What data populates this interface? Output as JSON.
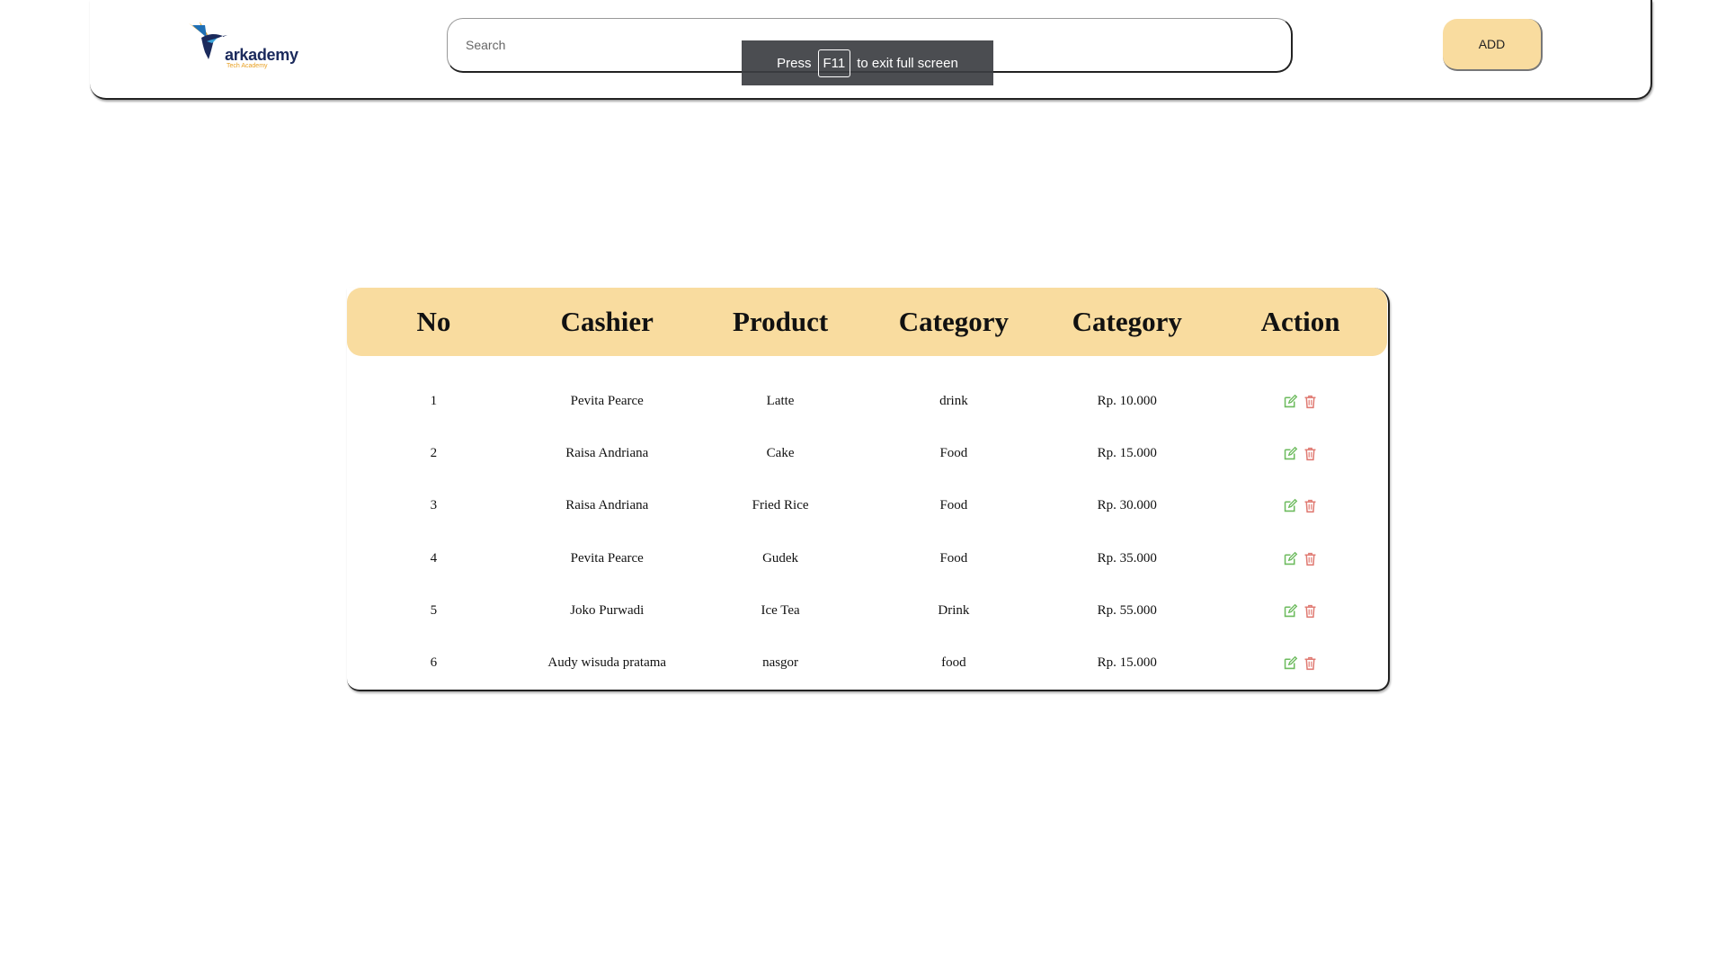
{
  "header": {
    "logo_text": "arkademy",
    "logo_subtext": "Tech Academy",
    "search_placeholder": "Search",
    "add_label": "ADD"
  },
  "fullscreen_notice": {
    "prefix": "Press",
    "key": "F11",
    "suffix": "to exit full screen"
  },
  "table": {
    "columns": [
      "No",
      "Cashier",
      "Product",
      "Category",
      "Category",
      "Action"
    ],
    "rows": [
      {
        "no": "1",
        "cashier": "Pevita Pearce",
        "product": "Latte",
        "category": "drink",
        "price": "Rp. 10.000"
      },
      {
        "no": "2",
        "cashier": "Raisa Andriana",
        "product": "Cake",
        "category": "Food",
        "price": "Rp. 15.000"
      },
      {
        "no": "3",
        "cashier": "Raisa Andriana",
        "product": "Fried Rice",
        "category": "Food",
        "price": "Rp. 30.000"
      },
      {
        "no": "4",
        "cashier": "Pevita Pearce",
        "product": "Gudek",
        "category": "Food",
        "price": "Rp. 35.000"
      },
      {
        "no": "5",
        "cashier": "Joko Purwadi",
        "product": "Ice Tea",
        "category": "Drink",
        "price": "Rp. 55.000"
      },
      {
        "no": "6",
        "cashier": "Audy wisuda pratama",
        "product": "nasgor",
        "category": "food",
        "price": "Rp. 15.000"
      }
    ],
    "action_icons": [
      "edit-icon",
      "delete-icon"
    ]
  },
  "colors": {
    "accent": "#f9dc9f",
    "edit_icon": "#6dbb5e",
    "delete_icon": "#e07b73",
    "toast_bg": "#3c3e42"
  }
}
